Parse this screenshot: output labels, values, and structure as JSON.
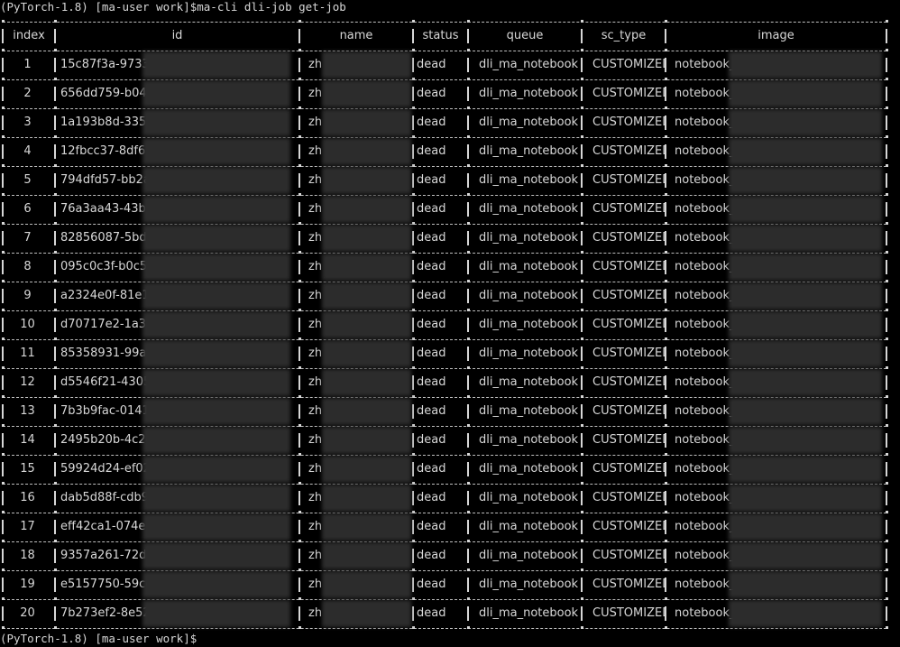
{
  "terminal": {
    "command_line": "(PyTorch-1.8) [ma-user work]$ma-cli dli-job get-job",
    "prompt_line": "(PyTorch-1.8) [ma-user work]$"
  },
  "table": {
    "columns": [
      "index",
      "id",
      "name",
      "status",
      "queue",
      "sc_type",
      "image"
    ],
    "rows": [
      {
        "index": "1",
        "id": "15c87f3a-9733",
        "name": "zh",
        "status": "dead",
        "queue": "dli_ma_notebook",
        "sc_type": "CUSTOMIZED",
        "image": "notebook_"
      },
      {
        "index": "2",
        "id": "656dd759-b045",
        "name": "zh",
        "status": "dead",
        "queue": "dli_ma_notebook",
        "sc_type": "CUSTOMIZED",
        "image": "notebook_"
      },
      {
        "index": "3",
        "id": "1a193b8d-335f",
        "name": "zh",
        "status": "dead",
        "queue": "dli_ma_notebook",
        "sc_type": "CUSTOMIZED",
        "image": "notebook_"
      },
      {
        "index": "4",
        "id": "12fbcc37-8df6",
        "name": "zh",
        "status": "dead",
        "queue": "dli_ma_notebook",
        "sc_type": "CUSTOMIZED",
        "image": "notebook_"
      },
      {
        "index": "5",
        "id": "794dfd57-bb2a",
        "name": "zh",
        "status": "dead",
        "queue": "dli_ma_notebook",
        "sc_type": "CUSTOMIZED",
        "image": "notebook_"
      },
      {
        "index": "6",
        "id": "76a3aa43-43b6",
        "name": "zh",
        "status": "dead",
        "queue": "dli_ma_notebook",
        "sc_type": "CUSTOMIZED",
        "image": "notebook_"
      },
      {
        "index": "7",
        "id": "82856087-5bd3",
        "name": "zh",
        "status": "dead",
        "queue": "dli_ma_notebook",
        "sc_type": "CUSTOMIZED",
        "image": "notebook_"
      },
      {
        "index": "8",
        "id": "095c0c3f-b0c5",
        "name": "zh",
        "status": "dead",
        "queue": "dli_ma_notebook",
        "sc_type": "CUSTOMIZED",
        "image": "notebook_"
      },
      {
        "index": "9",
        "id": "a2324e0f-81e1",
        "name": "zh",
        "status": "dead",
        "queue": "dli_ma_notebook",
        "sc_type": "CUSTOMIZED",
        "image": "notebook_"
      },
      {
        "index": "10",
        "id": "d70717e2-1a30",
        "name": "zh",
        "status": "dead",
        "queue": "dli_ma_notebook",
        "sc_type": "CUSTOMIZED",
        "image": "notebook_"
      },
      {
        "index": "11",
        "id": "85358931-99af",
        "name": "zh",
        "status": "dead",
        "queue": "dli_ma_notebook",
        "sc_type": "CUSTOMIZED",
        "image": "notebook_"
      },
      {
        "index": "12",
        "id": "d5546f21-4305",
        "name": "zh",
        "status": "dead",
        "queue": "dli_ma_notebook",
        "sc_type": "CUSTOMIZED",
        "image": "notebook_"
      },
      {
        "index": "13",
        "id": "7b3b9fac-0141",
        "name": "zh",
        "status": "dead",
        "queue": "dli_ma_notebook",
        "sc_type": "CUSTOMIZED",
        "image": "notebook_"
      },
      {
        "index": "14",
        "id": "2495b20b-4c2c",
        "name": "zh",
        "status": "dead",
        "queue": "dli_ma_notebook",
        "sc_type": "CUSTOMIZED",
        "image": "notebook_"
      },
      {
        "index": "15",
        "id": "59924d24-ef02",
        "name": "zh",
        "status": "dead",
        "queue": "dli_ma_notebook",
        "sc_type": "CUSTOMIZED",
        "image": "notebook_"
      },
      {
        "index": "16",
        "id": "dab5d88f-cdb9",
        "name": "zh",
        "status": "dead",
        "queue": "dli_ma_notebook",
        "sc_type": "CUSTOMIZED",
        "image": "notebook_"
      },
      {
        "index": "17",
        "id": "eff42ca1-074e",
        "name": "zh",
        "status": "dead",
        "queue": "dli_ma_notebook",
        "sc_type": "CUSTOMIZED",
        "image": "notebook_"
      },
      {
        "index": "18",
        "id": "9357a261-72d6",
        "name": "zh",
        "status": "dead",
        "queue": "dli_ma_notebook",
        "sc_type": "CUSTOMIZED",
        "image": "notebook_"
      },
      {
        "index": "19",
        "id": "e5157750-59cc",
        "name": "zh",
        "status": "dead",
        "queue": "dli_ma_notebook",
        "sc_type": "CUSTOMIZED",
        "image": "notebook_"
      },
      {
        "index": "20",
        "id": "7b273ef2-8e52",
        "name": "zh",
        "status": "dead",
        "queue": "dli_ma_notebook",
        "sc_type": "CUSTOMIZED",
        "image": "notebook_"
      }
    ]
  },
  "colors": {
    "background": "#000000",
    "text": "#d7d7d7",
    "border": "#bdbdbd",
    "redaction": "#2c2c2c"
  }
}
